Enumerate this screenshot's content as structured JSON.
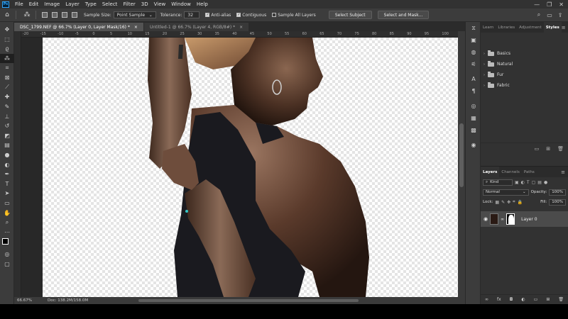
{
  "menu": {
    "logo": "Ps",
    "items": [
      "File",
      "Edit",
      "Image",
      "Layer",
      "Type",
      "Select",
      "Filter",
      "3D",
      "View",
      "Window",
      "Help"
    ],
    "window_controls": [
      "—",
      "❐",
      "✕"
    ]
  },
  "options": {
    "sample_size_label": "Sample Size:",
    "sample_size_value": "Point Sample",
    "tolerance_label": "Tolerance:",
    "tolerance_value": "32",
    "anti_alias_label": "Anti-alias",
    "contiguous_label": "Contiguous",
    "sample_all_layers_label": "Sample All Layers",
    "select_subject_label": "Select Subject",
    "select_and_mask_label": "Select and Mask..."
  },
  "tabs": [
    {
      "title": "DSC_1799.NEF @ 66.7% (Layer 0, Layer Mask/16) *",
      "close": "×"
    },
    {
      "title": "Untitled-1 @ 66.7% (Layer 4, RGB/8#) *",
      "close": "×"
    }
  ],
  "ruler": {
    "ticks": [
      "-20",
      "-15",
      "-10",
      "-5",
      "0",
      "5",
      "10",
      "15",
      "20",
      "25",
      "30",
      "35",
      "40",
      "45",
      "50",
      "55",
      "60",
      "65",
      "70",
      "75",
      "80",
      "85",
      "90",
      "95",
      "100"
    ]
  },
  "status": {
    "zoom": "66.67%",
    "doc": "Doc: 138.2M/158.0M"
  },
  "styles_panel": {
    "tabs": [
      "Learn",
      "Libraries",
      "Adjustment",
      "Styles"
    ],
    "active_tab": "Styles",
    "folders": [
      "Basics",
      "Natural",
      "Fur",
      "Fabric"
    ]
  },
  "layers_panel": {
    "tabs": [
      "Layers",
      "Channels",
      "Paths"
    ],
    "active_tab": "Layers",
    "filter_label": "Kind",
    "blend_mode": "Normal",
    "opacity_label": "Opacity:",
    "opacity_value": "100%",
    "lock_label": "Lock:",
    "fill_label": "Fill:",
    "fill_value": "100%",
    "layer_name": "Layer 0"
  }
}
